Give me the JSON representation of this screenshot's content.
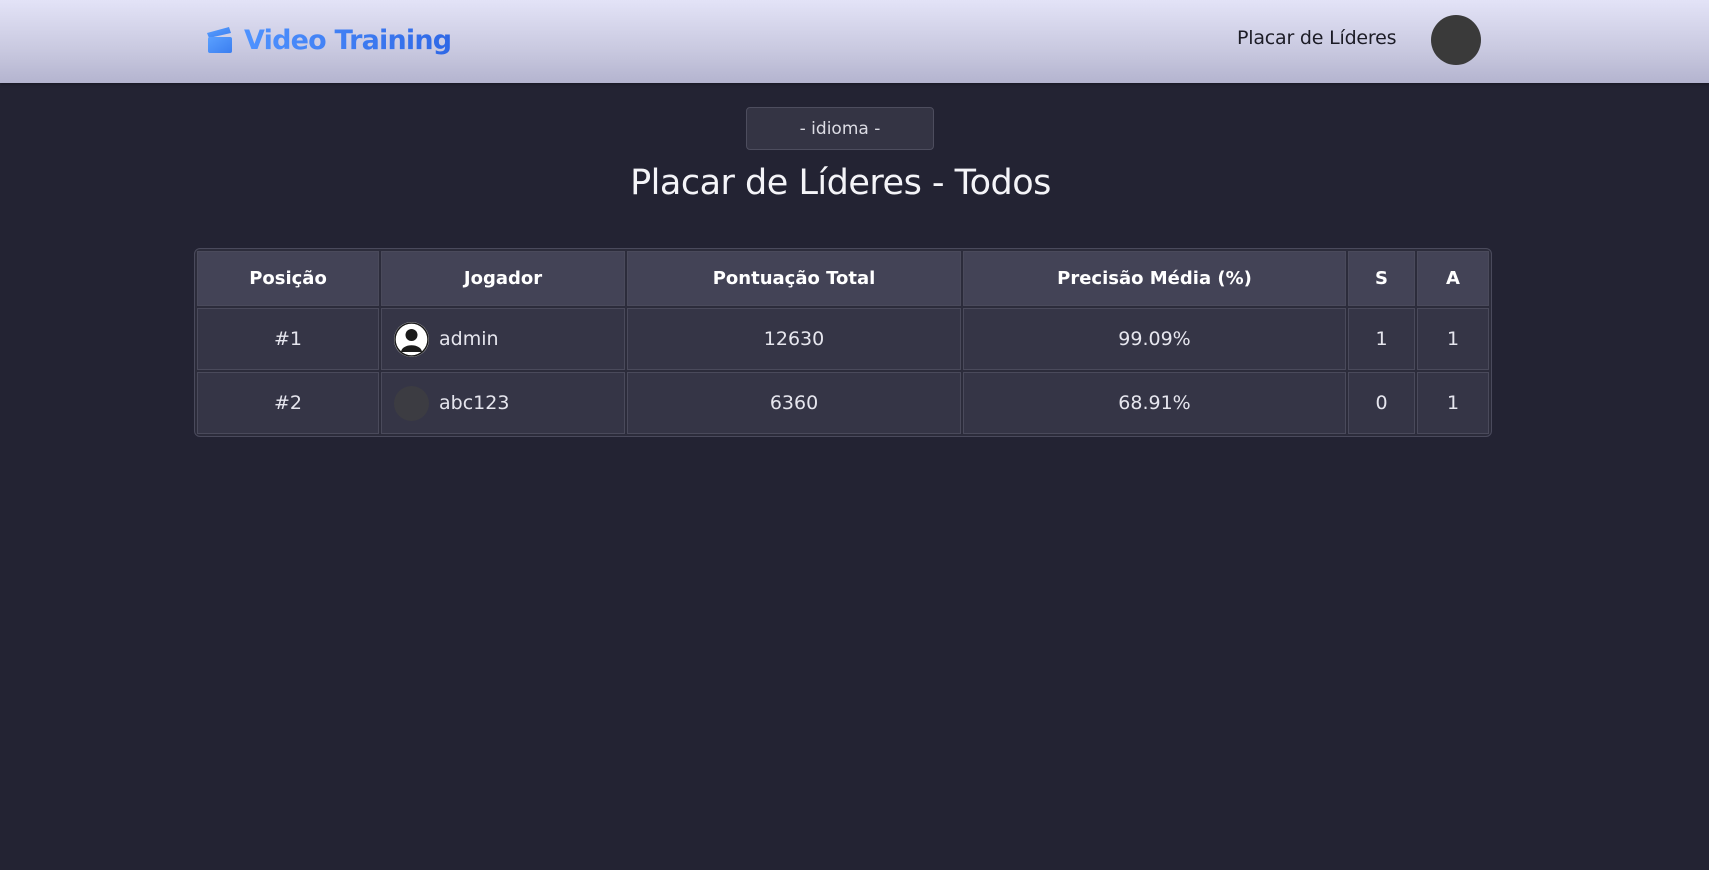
{
  "brand": {
    "title": "Video Training",
    "icon": "clapperboard-icon",
    "accent": "#3a7bf0"
  },
  "nav": {
    "leaderboard_link": "Placar de Líderes"
  },
  "language_select": {
    "selected": "- idioma -"
  },
  "page": {
    "title": "Placar de Líderes - Todos"
  },
  "table": {
    "headers": [
      "Posição",
      "Jogador",
      "Pontuação Total",
      "Precisão Média (%)",
      "S",
      "A"
    ],
    "rows": [
      {
        "position": "#1",
        "player": "admin",
        "avatar": "default-user-icon",
        "total": "12630",
        "accuracy": "99.09%",
        "s": "1",
        "a": "1"
      },
      {
        "position": "#2",
        "player": "abc123",
        "avatar": "blank-avatar",
        "total": "6360",
        "accuracy": "68.91%",
        "s": "0",
        "a": "1"
      }
    ]
  }
}
